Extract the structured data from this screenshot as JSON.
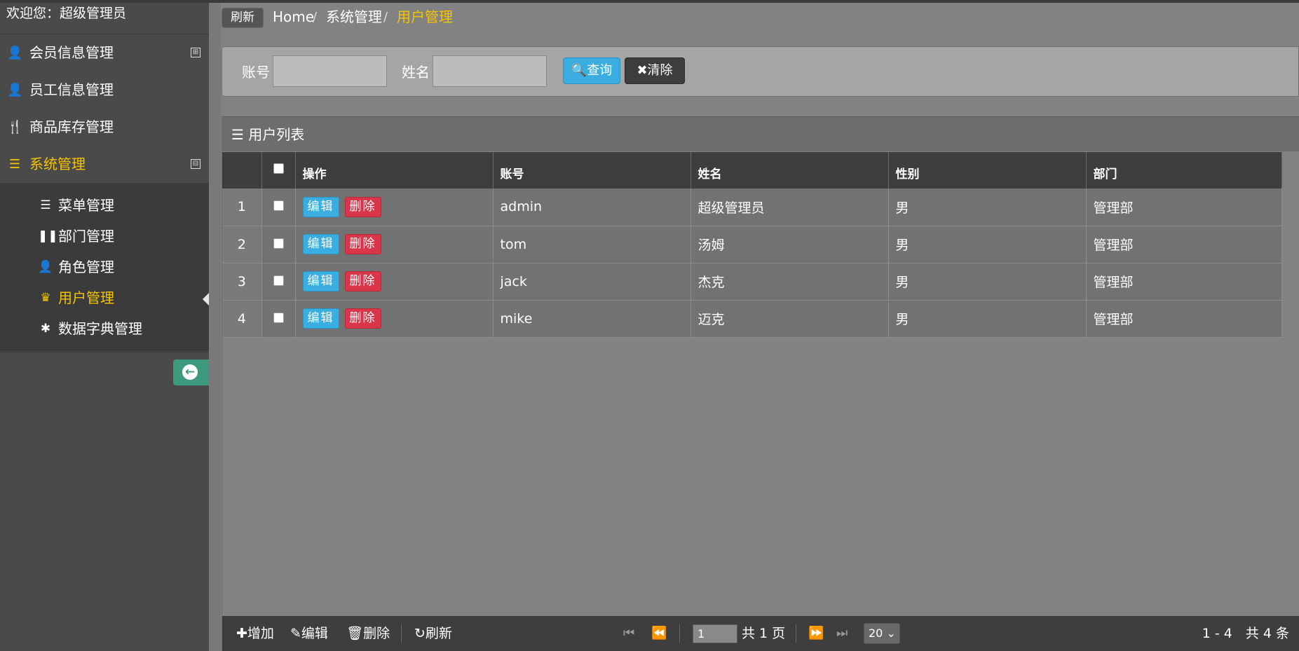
{
  "sidebar": {
    "welcome": "欢迎您：超级管理员",
    "menus": [
      {
        "label": "会员信息管理",
        "icon": "user-icon",
        "expand": "⊞"
      },
      {
        "label": "员工信息管理",
        "icon": "user-icon"
      },
      {
        "label": "商品库存管理",
        "icon": "cutlery-icon"
      },
      {
        "label": "系统管理",
        "icon": "list-icon",
        "expand": "⊟",
        "active": true
      }
    ],
    "submenu": [
      {
        "label": "菜单管理",
        "icon": "list-icon"
      },
      {
        "label": "部门管理",
        "icon": "pause-icon"
      },
      {
        "label": "角色管理",
        "icon": "user-icon"
      },
      {
        "label": "用户管理",
        "icon": "king-icon",
        "active": true
      },
      {
        "label": "数据字典管理",
        "icon": "asterisk-icon"
      }
    ]
  },
  "breadcrumb": {
    "refresh": "刷新",
    "items": [
      "Home",
      "系统管理",
      "用户管理"
    ],
    "separator": "/"
  },
  "search": {
    "account_label": "账号",
    "account_value": "",
    "name_label": "姓名",
    "name_value": "",
    "query_button": "查询",
    "clear_button": "清除"
  },
  "grid": {
    "title": "用户列表",
    "columns": [
      "操作",
      "账号",
      "姓名",
      "性别",
      "部门"
    ],
    "edit_label": "编辑",
    "delete_label": "删除",
    "rows": [
      {
        "num": "1",
        "account": "admin",
        "name": "超级管理员",
        "gender": "男",
        "dept": "管理部"
      },
      {
        "num": "2",
        "account": "tom",
        "name": "汤姆",
        "gender": "男",
        "dept": "管理部"
      },
      {
        "num": "3",
        "account": "jack",
        "name": "杰克",
        "gender": "男",
        "dept": "管理部"
      },
      {
        "num": "4",
        "account": "mike",
        "name": "迈克",
        "gender": "男",
        "dept": "管理部"
      }
    ]
  },
  "footer": {
    "add": "增加",
    "edit": "编辑",
    "delete": "删除",
    "refresh": "刷新",
    "page_value": "1",
    "page_total": "共 1 页",
    "page_size": "20",
    "summary": "1 - 4　共 4 条"
  },
  "colors": {
    "accent": "#f5c400",
    "primary_button": "#3aaee0",
    "danger_button": "#d9364a",
    "collapse_button": "#3e9a7f"
  }
}
